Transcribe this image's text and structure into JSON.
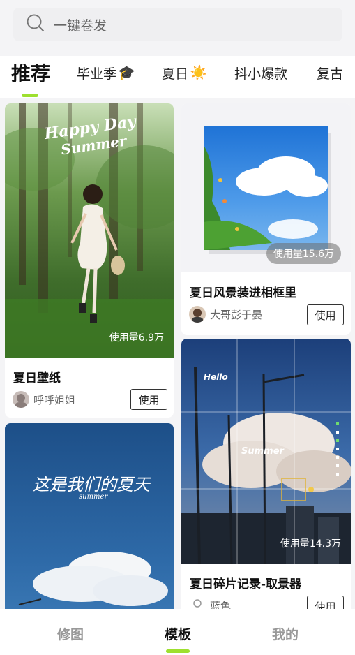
{
  "search": {
    "placeholder": "一键卷发",
    "icon": "search-icon"
  },
  "tabs": [
    {
      "label": "推荐",
      "emoji": "",
      "active": true
    },
    {
      "label": "毕业季",
      "emoji": "🎓",
      "active": false
    },
    {
      "label": "夏日",
      "emoji": "☀️",
      "active": false
    },
    {
      "label": "抖小爆款",
      "emoji": "",
      "active": false
    },
    {
      "label": "复古",
      "emoji": "",
      "active": false
    }
  ],
  "cards": [
    {
      "title": "夏日壁纸",
      "author": "呼呼姐姐",
      "usage": "使用量6.9万",
      "use_label": "使用",
      "overlay_title": "Happy Day",
      "overlay_sub": "Summer"
    },
    {
      "title": "夏日风景装进相框里",
      "author": "大哥彭于晏",
      "usage": "使用量15.6万",
      "use_label": "使用"
    },
    {
      "title": "",
      "author": "",
      "usage": "",
      "use_label": "",
      "overlay_title": "这是我们的夏天",
      "overlay_sub": "summer"
    },
    {
      "title": "夏日碎片记录-取景器",
      "author": "蓝色",
      "usage": "使用量14.3万",
      "use_label": "使用",
      "overlay_hello": "Hello",
      "overlay_summer": "Summer"
    }
  ],
  "bottom_nav": [
    {
      "label": "修图",
      "active": false
    },
    {
      "label": "模板",
      "active": true
    },
    {
      "label": "我的",
      "active": false
    }
  ],
  "colors": {
    "accent": "#9ee02f",
    "inactive_nav": "#999999"
  }
}
